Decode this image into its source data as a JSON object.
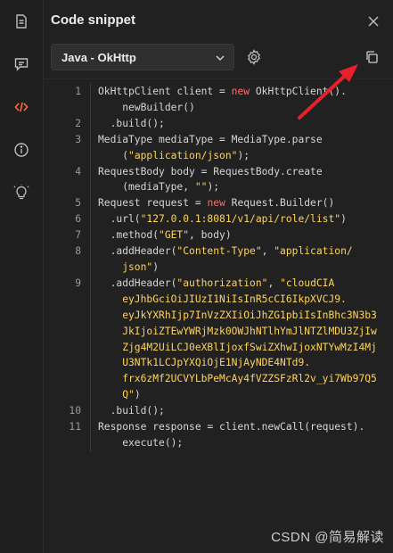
{
  "title": "Code snippet",
  "language_select": {
    "value": "Java - OkHttp"
  },
  "sidebar": {
    "icons": [
      "document-icon",
      "comment-icon",
      "code-icon",
      "info-icon",
      "lightbulb-icon"
    ],
    "active": "code-icon"
  },
  "accent_color": "#ff6c37",
  "code": [
    {
      "n": "1",
      "lines": [
        [
          {
            "t": "OkHttpClient client = "
          },
          {
            "k": "new"
          },
          {
            "t": " OkHttpClient()."
          }
        ],
        [
          {
            "t": "    newBuilder()"
          }
        ]
      ]
    },
    {
      "n": "2",
      "lines": [
        [
          {
            "t": "  .build();"
          }
        ]
      ]
    },
    {
      "n": "3",
      "lines": [
        [
          {
            "t": "MediaType mediaType = MediaType.parse"
          }
        ],
        [
          {
            "t": "    ("
          },
          {
            "s": "\"application/json\""
          },
          {
            "t": ");"
          }
        ]
      ]
    },
    {
      "n": "4",
      "lines": [
        [
          {
            "t": "RequestBody body = RequestBody.create"
          }
        ],
        [
          {
            "t": "    (mediaType, "
          },
          {
            "s": "\"\""
          },
          {
            "t": ");"
          }
        ]
      ]
    },
    {
      "n": "5",
      "lines": [
        [
          {
            "t": "Request request = "
          },
          {
            "k": "new"
          },
          {
            "t": " Request.Builder()"
          }
        ]
      ]
    },
    {
      "n": "6",
      "lines": [
        [
          {
            "t": "  .url("
          },
          {
            "s": "\"127.0.0.1:8081/v1/api/role/list\""
          },
          {
            "t": ")"
          }
        ]
      ]
    },
    {
      "n": "7",
      "lines": [
        [
          {
            "t": "  .method("
          },
          {
            "s": "\"GET\""
          },
          {
            "t": ", body)"
          }
        ]
      ]
    },
    {
      "n": "8",
      "lines": [
        [
          {
            "t": "  .addHeader("
          },
          {
            "s": "\"Content-Type\""
          },
          {
            "t": ", "
          },
          {
            "s": "\"application/"
          }
        ],
        [
          {
            "s": "    json\""
          },
          {
            "t": ")"
          }
        ]
      ]
    },
    {
      "n": "9",
      "lines": [
        [
          {
            "t": "  .addHeader("
          },
          {
            "s": "\"authorization\""
          },
          {
            "t": ", "
          },
          {
            "s": "\"cloudCIA"
          }
        ],
        [
          {
            "s": "    eyJhbGciOiJIUzI1NiIsInR5cCI6IkpXVCJ9."
          }
        ],
        [
          {
            "s": "    eyJkYXRhIjp7InVzZXIiOiJhZG1pbiIsInBhc3N3b3"
          }
        ],
        [
          {
            "s": "    JkIjoiZTEwYWRjMzk0OWJhNTlhYmJlNTZlMDU3ZjIw"
          }
        ],
        [
          {
            "s": "    Zjg4M2UiLCJ0eXBlIjoxfSwiZXhwIjoxNTYwMzI4Mj"
          }
        ],
        [
          {
            "s": "    U3NTk1LCJpYXQiOjE1NjAyNDE4NTd9."
          }
        ],
        [
          {
            "s": "    frx6zMf2UCVYLbPeMcAy4fVZZSFzRl2v_yi7Wb97Q5"
          }
        ],
        [
          {
            "s": "    Q\""
          },
          {
            "t": ")"
          }
        ]
      ]
    },
    {
      "n": "10",
      "lines": [
        [
          {
            "t": "  .build();"
          }
        ]
      ]
    },
    {
      "n": "11",
      "lines": [
        [
          {
            "t": "Response response = client.newCall(request)."
          }
        ],
        [
          {
            "t": "    execute();"
          }
        ]
      ]
    }
  ],
  "watermark": "CSDN @简易解读"
}
